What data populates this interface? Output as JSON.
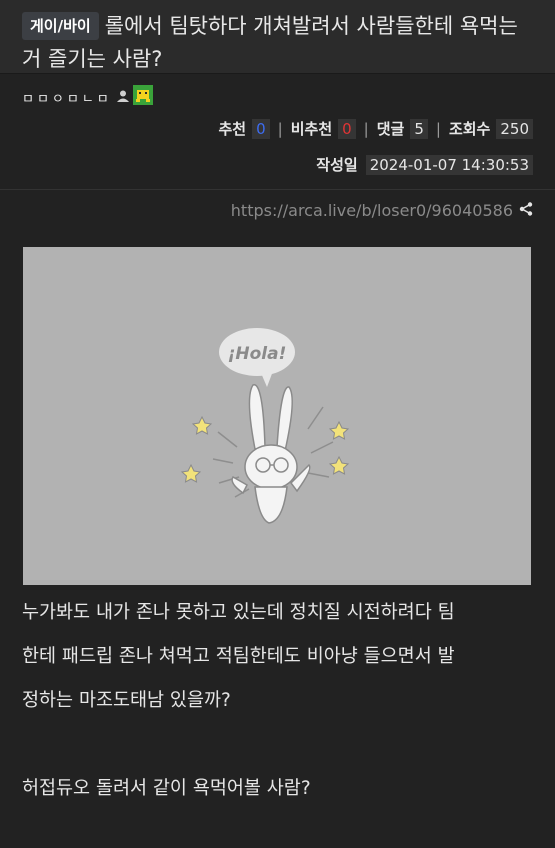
{
  "post": {
    "category": "게이/바이",
    "title": "롤에서 팀탓하다 개쳐발려서 사람들한테 욕먹는거 즐기는 사람?",
    "author": "ㅁㅁㅇㅁㄴㅁ",
    "stats": {
      "recommend_label": "추천",
      "recommend_value": "0",
      "downvote_label": "비추천",
      "downvote_value": "0",
      "comments_label": "댓글",
      "comments_value": "5",
      "views_label": "조회수",
      "views_value": "250"
    },
    "date_label": "작성일",
    "date_value": "2024-01-07 14:30:53",
    "url": "https://arca.live/b/loser0/96040586",
    "image_text": "¡Hola!",
    "body_lines": [
      "누가봐도 내가 존나 못하고 있는데 정치질 시전하려다 팀",
      "한테 패드립 존나 쳐먹고 적팀한테도 비아냥 들으면서 발",
      "정하는 마조도태남 있을까?",
      "",
      "허접듀오 돌려서 같이 욕먹어볼 사람?"
    ]
  },
  "colors": {
    "background": "#222222",
    "recommend": "#3d6cf0",
    "downvote": "#e03434",
    "image_bg": "#b2b2b2"
  },
  "icons": [
    "user-icon",
    "badge-icon",
    "share-icon",
    "bunny-illustration"
  ]
}
